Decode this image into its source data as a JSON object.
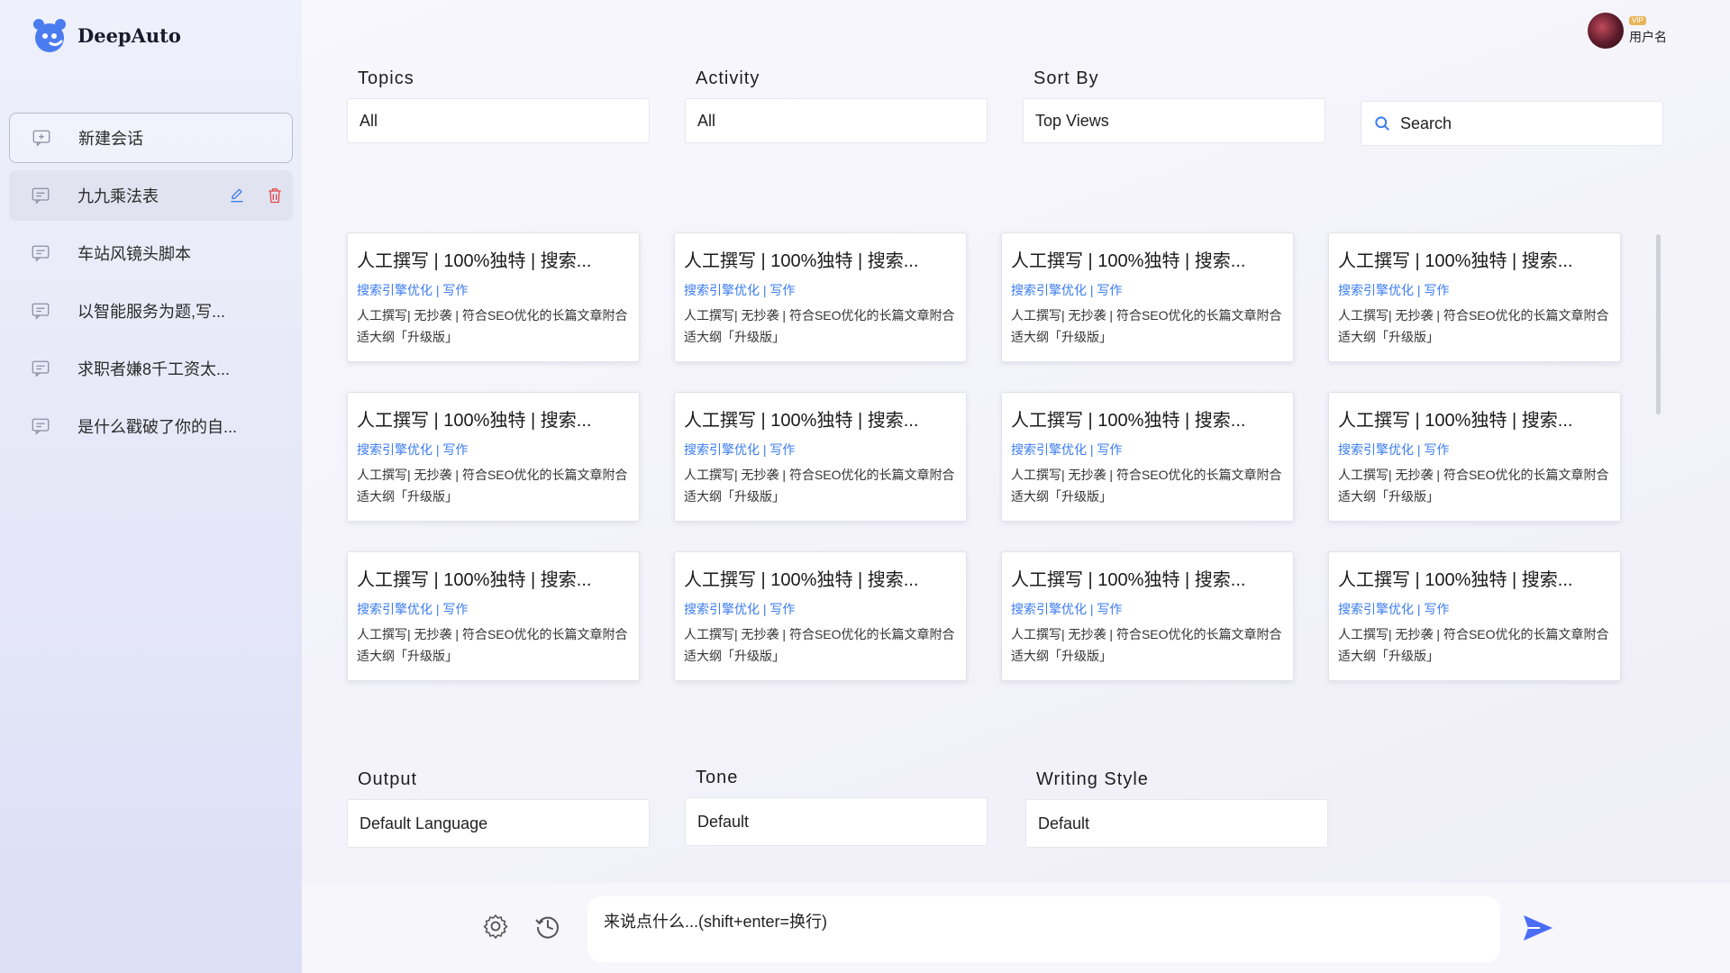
{
  "app": {
    "name": "DeepAuto"
  },
  "sidebar": {
    "new_chat_label": "新建会话",
    "items": [
      {
        "label": "九九乘法表",
        "active": true
      },
      {
        "label": "车站风镜头脚本"
      },
      {
        "label": "以智能服务为题,写..."
      },
      {
        "label": "求职者嫌8千工资太..."
      },
      {
        "label": "是什么戳破了你的自..."
      }
    ]
  },
  "user": {
    "name": "用户名",
    "badge": "VIP"
  },
  "filters": {
    "topics": {
      "label": "Topics",
      "value": "All"
    },
    "activity": {
      "label": "Activity",
      "value": "All"
    },
    "sort": {
      "label": "Sort By",
      "value": "Top Views"
    },
    "search": {
      "placeholder": "Search"
    }
  },
  "cards": [
    {
      "title": "人工撰写 | 100%独特 | 搜索...",
      "tags": "搜索引擎优化 | 写作",
      "desc": "人工撰写| 无抄袭 | 符合SEO优化的长篇文章附合适大纲「升级版」"
    },
    {
      "title": "人工撰写 | 100%独特 | 搜索...",
      "tags": "搜索引擎优化 | 写作",
      "desc": "人工撰写| 无抄袭 | 符合SEO优化的长篇文章附合适大纲「升级版」"
    },
    {
      "title": "人工撰写 | 100%独特 | 搜索...",
      "tags": "搜索引擎优化 | 写作",
      "desc": "人工撰写| 无抄袭 | 符合SEO优化的长篇文章附合适大纲「升级版」"
    },
    {
      "title": "人工撰写 | 100%独特 | 搜索...",
      "tags": "搜索引擎优化 | 写作",
      "desc": "人工撰写| 无抄袭 | 符合SEO优化的长篇文章附合适大纲「升级版」"
    },
    {
      "title": "人工撰写 | 100%独特 | 搜索...",
      "tags": "搜索引擎优化 | 写作",
      "desc": "人工撰写| 无抄袭 | 符合SEO优化的长篇文章附合适大纲「升级版」"
    },
    {
      "title": "人工撰写 | 100%独特 | 搜索...",
      "tags": "搜索引擎优化 | 写作",
      "desc": "人工撰写| 无抄袭 | 符合SEO优化的长篇文章附合适大纲「升级版」"
    },
    {
      "title": "人工撰写 | 100%独特 | 搜索...",
      "tags": "搜索引擎优化 | 写作",
      "desc": "人工撰写| 无抄袭 | 符合SEO优化的长篇文章附合适大纲「升级版」"
    },
    {
      "title": "人工撰写 | 100%独特 | 搜索...",
      "tags": "搜索引擎优化 | 写作",
      "desc": "人工撰写| 无抄袭 | 符合SEO优化的长篇文章附合适大纲「升级版」"
    },
    {
      "title": "人工撰写 | 100%独特 | 搜索...",
      "tags": "搜索引擎优化 | 写作",
      "desc": "人工撰写| 无抄袭 | 符合SEO优化的长篇文章附合适大纲「升级版」"
    },
    {
      "title": "人工撰写 | 100%独特 | 搜索...",
      "tags": "搜索引擎优化 | 写作",
      "desc": "人工撰写| 无抄袭 | 符合SEO优化的长篇文章附合适大纲「升级版」"
    },
    {
      "title": "人工撰写 | 100%独特 | 搜索...",
      "tags": "搜索引擎优化 | 写作",
      "desc": "人工撰写| 无抄袭 | 符合SEO优化的长篇文章附合适大纲「升级版」"
    },
    {
      "title": "人工撰写 | 100%独特 | 搜索...",
      "tags": "搜索引擎优化 | 写作",
      "desc": "人工撰写| 无抄袭 | 符合SEO优化的长篇文章附合适大纲「升级版」"
    }
  ],
  "options": {
    "output": {
      "label": "Output",
      "value": "Default Language"
    },
    "tone": {
      "label": "Tone",
      "value": "Default"
    },
    "writing_style": {
      "label": "Writing Style",
      "value": "Default"
    }
  },
  "composer": {
    "placeholder": "来说点什么...(shift+enter=换行)"
  },
  "colors": {
    "accent": "#3b7cf0",
    "delete": "#e5484d",
    "send": "#4a6cf7"
  },
  "icons": {
    "logo": "bear-logo-icon",
    "chat": "chat-bubble-icon",
    "edit": "pencil-icon",
    "delete": "trash-icon",
    "search": "search-icon",
    "settings": "gear-icon",
    "history": "history-icon",
    "send": "send-icon"
  }
}
